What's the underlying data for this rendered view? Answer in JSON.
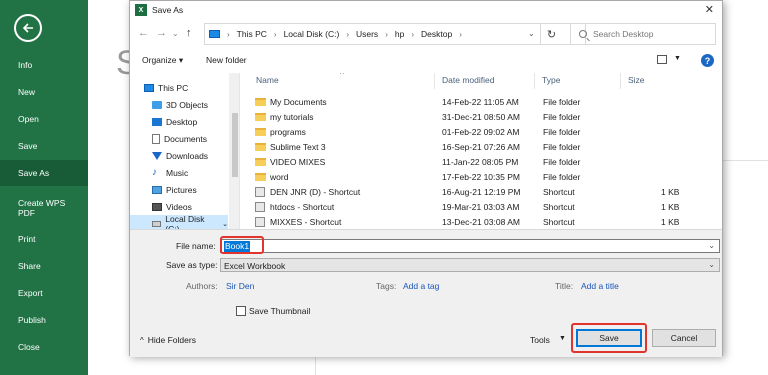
{
  "backstage": {
    "back_icon": "back-arrow-icon",
    "items": [
      "Info",
      "New",
      "Open",
      "Save",
      "Save As",
      "Create WPS PDF",
      "Print",
      "Share",
      "Export",
      "Publish",
      "Close"
    ],
    "active": "Save As",
    "colors": {
      "background": "#217346",
      "active": "#185c37"
    }
  },
  "background": {
    "letter": "S"
  },
  "dialog": {
    "title": "Save As",
    "app_icon": "X",
    "close_label": "✕",
    "address": {
      "breadcrumbs": [
        "This PC",
        "Local Disk (C:)",
        "Users",
        "hp",
        "Desktop"
      ]
    },
    "search_placeholder": "Search Desktop",
    "toolbar": {
      "organize": "Organize ▾",
      "new_folder": "New folder",
      "help": "?"
    },
    "nav": [
      "This PC",
      "3D Objects",
      "Desktop",
      "Documents",
      "Downloads",
      "Music",
      "Pictures",
      "Videos",
      "Local Disk (C:)"
    ],
    "nav_selected": "Local Disk (C:)",
    "columns": [
      "Name",
      "Date modified",
      "Type",
      "Size"
    ],
    "files": [
      {
        "name": "My Documents",
        "date": "14-Feb-22 11:05 AM",
        "type": "File folder",
        "size": "",
        "kind": "folder"
      },
      {
        "name": "my tutorials",
        "date": "31-Dec-21 08:50 AM",
        "type": "File folder",
        "size": "",
        "kind": "folder"
      },
      {
        "name": "programs",
        "date": "01-Feb-22 09:02 AM",
        "type": "File folder",
        "size": "",
        "kind": "folder"
      },
      {
        "name": "Sublime Text 3",
        "date": "16-Sep-21 07:26 AM",
        "type": "File folder",
        "size": "",
        "kind": "folder"
      },
      {
        "name": "VIDEO MIXES",
        "date": "11-Jan-22 08:05 PM",
        "type": "File folder",
        "size": "",
        "kind": "folder"
      },
      {
        "name": "word",
        "date": "17-Feb-22 10:35 PM",
        "type": "File folder",
        "size": "",
        "kind": "folder"
      },
      {
        "name": "DEN JNR (D) - Shortcut",
        "date": "16-Aug-21 12:19 PM",
        "type": "Shortcut",
        "size": "1 KB",
        "kind": "shortcut"
      },
      {
        "name": "htdocs - Shortcut",
        "date": "19-Mar-21 03:03 AM",
        "type": "Shortcut",
        "size": "1 KB",
        "kind": "shortcut"
      },
      {
        "name": "MIXXES - Shortcut",
        "date": "13-Dec-21 03:08 AM",
        "type": "Shortcut",
        "size": "1 KB",
        "kind": "shortcut"
      }
    ],
    "form": {
      "file_name_label": "File name:",
      "file_name_value": "Book1",
      "save_as_type_label": "Save as type:",
      "save_as_type_value": "Excel Workbook",
      "authors_label": "Authors:",
      "authors_value": "Sir Den",
      "tags_label": "Tags:",
      "tags_value": "Add a tag",
      "title_label": "Title:",
      "title_value": "Add a title",
      "save_thumbnail": "Save Thumbnail",
      "hide_folders": "Hide Folders",
      "tools": "Tools",
      "save": "Save",
      "cancel": "Cancel"
    },
    "colors": {
      "highlight": "#e0342c",
      "selection": "#0078d7",
      "link": "#1a56b8"
    }
  }
}
